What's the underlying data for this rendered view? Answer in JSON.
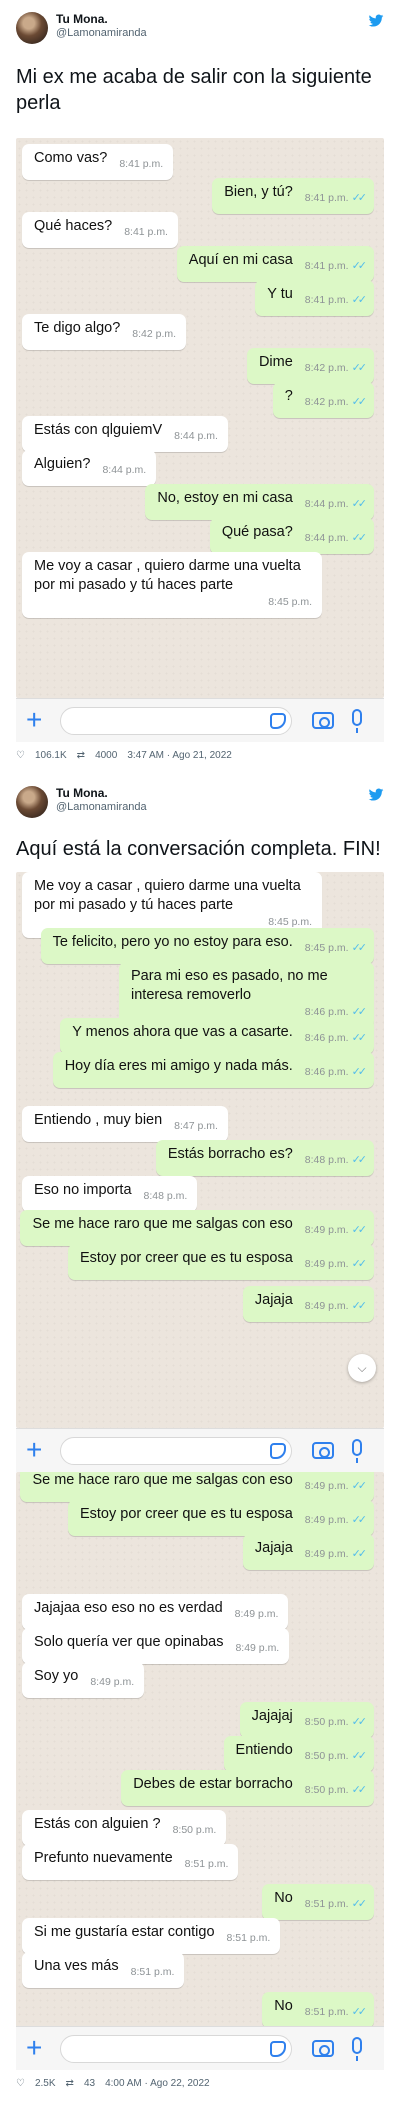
{
  "tweet1": {
    "name": "Tu Mona.",
    "handle": "@Lamonamiranda",
    "text": "Mi ex me acaba de salir con la siguiente perla",
    "messages": [
      {
        "dir": "in",
        "text": "Como vas?",
        "time": "8:41 p.m."
      },
      {
        "dir": "out",
        "text": "Bien, y tú?",
        "time": "8:41 p.m."
      },
      {
        "dir": "in",
        "text": "Qué haces?",
        "time": "8:41 p.m."
      },
      {
        "dir": "out",
        "text": "Aquí en mi casa",
        "time": "8:41 p.m."
      },
      {
        "dir": "out",
        "text": "Y tu",
        "time": "8:41 p.m."
      },
      {
        "dir": "in",
        "text": "Te digo algo?",
        "time": "8:42 p.m."
      },
      {
        "dir": "out",
        "text": "Dime",
        "time": "8:42 p.m."
      },
      {
        "dir": "out",
        "text": "?",
        "time": "8:42 p.m."
      },
      {
        "dir": "in",
        "text": "Estás con qlguiemV",
        "time": "8:44 p.m."
      },
      {
        "dir": "in",
        "text": "Alguien?",
        "time": "8:44 p.m."
      },
      {
        "dir": "out",
        "text": "No, estoy en mi casa",
        "time": "8:44 p.m."
      },
      {
        "dir": "out",
        "text": "Qué pasa?",
        "time": "8:44 p.m."
      },
      {
        "dir": "in",
        "text": "Me voy a casar , quiero darme una vuelta por mi pasado y tú haces parte",
        "time": "8:45 p.m."
      }
    ],
    "likes": "106.1K",
    "retweets": "4000",
    "timestamp": "3:47 AM · Ago 21, 2022"
  },
  "tweet2": {
    "name": "Tu Mona.",
    "handle": "@Lamonamiranda",
    "text": "Aquí está la conversación completa. FIN!",
    "messages_a": [
      {
        "dir": "in",
        "text": "Me voy a casar , quiero darme una vuelta por mi pasado y tú haces parte",
        "time": "8:45 p.m."
      },
      {
        "dir": "out",
        "text": "Te felicito, pero yo no estoy para eso.",
        "time": "8:45 p.m."
      },
      {
        "dir": "out",
        "text": "Para mi eso es pasado, no me interesa removerlo",
        "time": "8:46 p.m."
      },
      {
        "dir": "out",
        "text": "Y menos ahora que vas a casarte.",
        "time": "8:46 p.m."
      },
      {
        "dir": "out",
        "text": "Hoy día eres mi amigo y nada más.",
        "time": "8:46 p.m."
      },
      {
        "dir": "in",
        "text": "Entiendo , muy bien",
        "time": "8:47 p.m."
      },
      {
        "dir": "out",
        "text": "Estás borracho es?",
        "time": "8:48 p.m."
      },
      {
        "dir": "in",
        "text": "Eso no importa",
        "time": "8:48 p.m."
      },
      {
        "dir": "out",
        "text": "Se me hace raro que me salgas con eso",
        "time": "8:49 p.m."
      },
      {
        "dir": "out",
        "text": "Estoy por creer que es tu esposa",
        "time": "8:49 p.m."
      },
      {
        "dir": "out",
        "text": "Jajaja",
        "time": "8:49 p.m."
      }
    ],
    "messages_b": [
      {
        "dir": "out",
        "text": "Se me hace raro que me salgas con eso",
        "time": "8:49 p.m."
      },
      {
        "dir": "out",
        "text": "Estoy por creer que es tu esposa",
        "time": "8:49 p.m."
      },
      {
        "dir": "out",
        "text": "Jajaja",
        "time": "8:49 p.m."
      },
      {
        "dir": "in",
        "text": "Jajajaa eso eso no es verdad",
        "time": "8:49 p.m."
      },
      {
        "dir": "in",
        "text": "Solo quería ver que opinabas",
        "time": "8:49 p.m."
      },
      {
        "dir": "in",
        "text": "Soy yo",
        "time": "8:49 p.m."
      },
      {
        "dir": "out",
        "text": "Jajajaj",
        "time": "8:50 p.m."
      },
      {
        "dir": "out",
        "text": "Entiendo",
        "time": "8:50 p.m."
      },
      {
        "dir": "out",
        "text": "Debes de estar borracho",
        "time": "8:50 p.m."
      },
      {
        "dir": "in",
        "text": "Estás con alguien ?",
        "time": "8:50 p.m."
      },
      {
        "dir": "in",
        "text": "Prefunto nuevamente",
        "time": "8:51 p.m."
      },
      {
        "dir": "out",
        "text": "No",
        "time": "8:51 p.m."
      },
      {
        "dir": "in",
        "text": "Si me gustaría estar contigo",
        "time": "8:51 p.m."
      },
      {
        "dir": "in",
        "text": "Una ves más",
        "time": "8:51 p.m."
      },
      {
        "dir": "out",
        "text": "No",
        "time": "8:51 p.m."
      }
    ],
    "likes": "2.5K",
    "retweets": "43",
    "timestamp": "4:00 AM · Ago 22, 2022"
  },
  "colors": {
    "chat_bg": "#ece5dd",
    "out_bubble": "#dcf8c6",
    "in_bubble": "#ffffff",
    "accent": "#2f80ed",
    "twitter_blue": "#1d9bf0",
    "read_ticks": "#53bdeb"
  },
  "icons": {
    "like": "heart-icon",
    "retweet": "retweet-icon",
    "attach": "plus-icon",
    "sticker": "sticker-icon",
    "camera": "camera-icon",
    "mic": "mic-icon",
    "brand": "twitter-bird-icon",
    "scroll": "chevron-down-icon"
  }
}
